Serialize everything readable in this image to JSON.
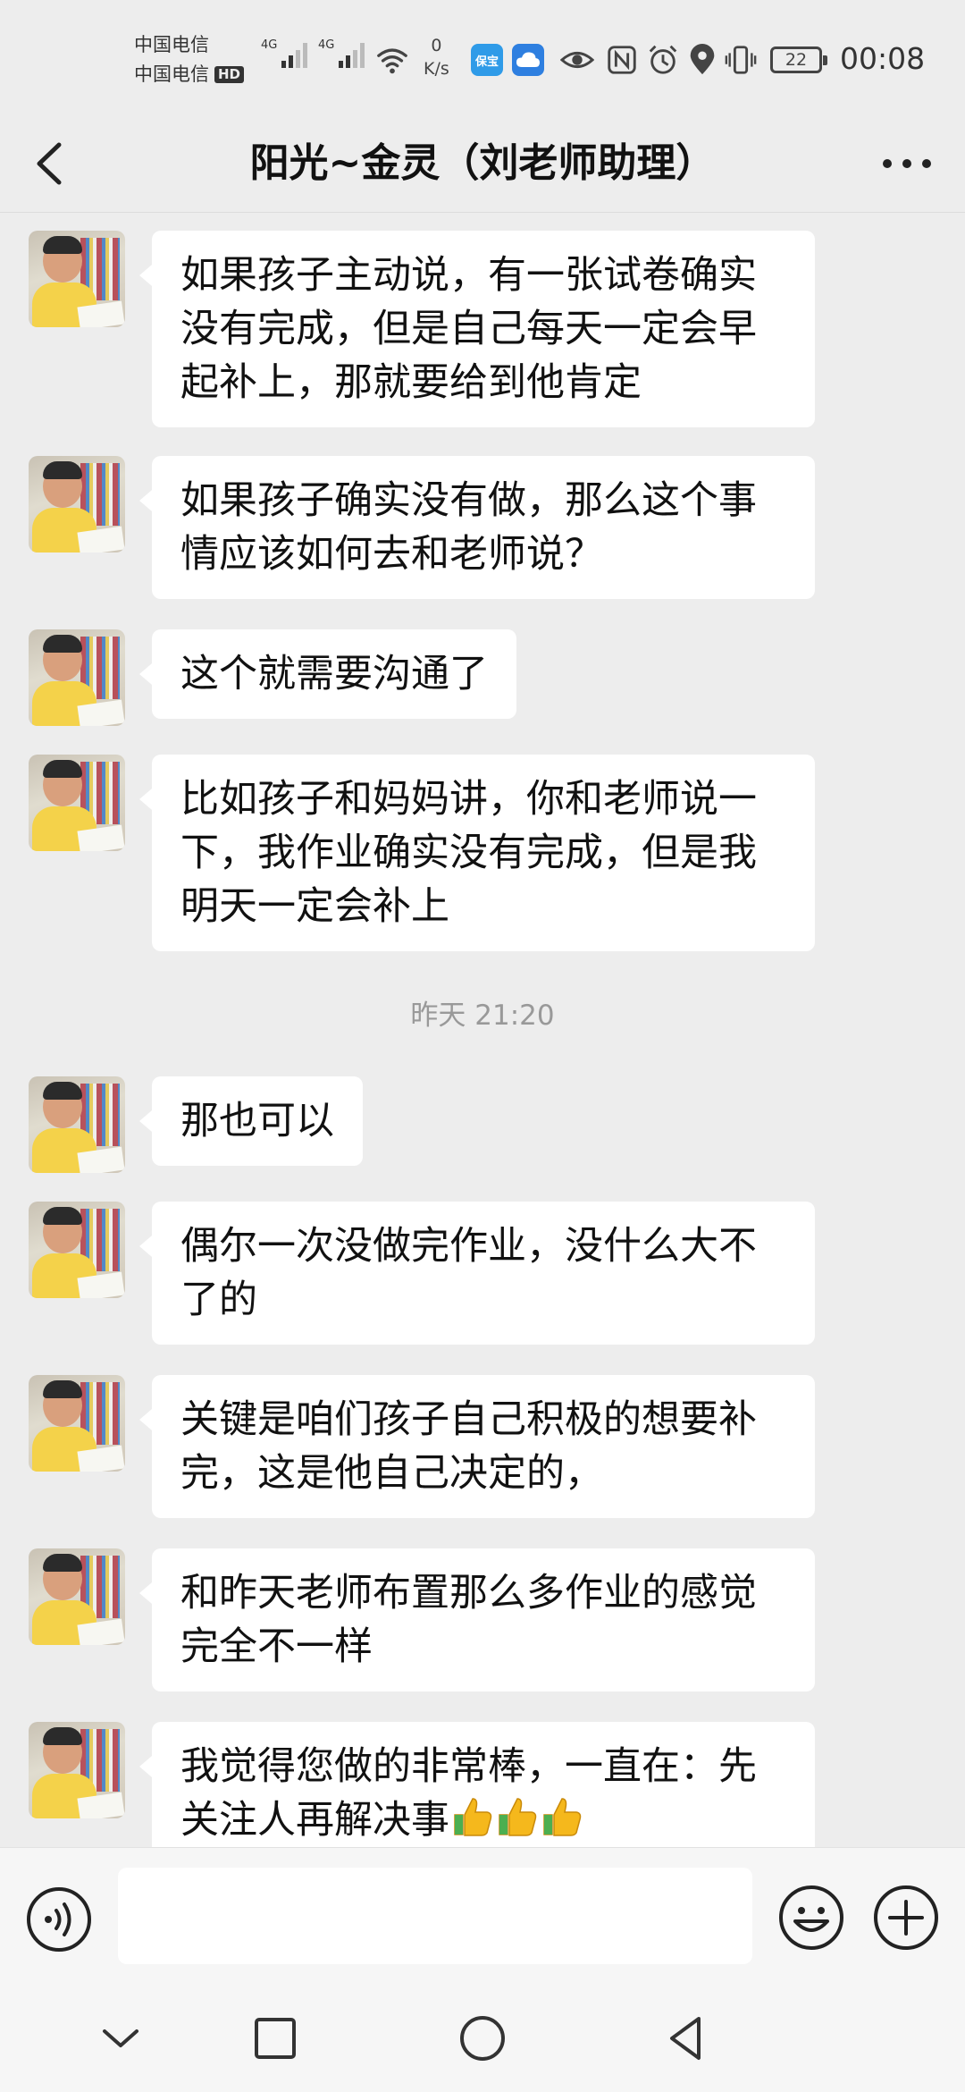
{
  "status_bar": {
    "carrier_1": "中国电信",
    "carrier_2": "中国电信",
    "hd_badge": "HD",
    "signal_1_label": "4G",
    "signal_2_label": "4G",
    "net_speed_value": "0",
    "net_speed_unit": "K/s",
    "app_badge_1": "保宝",
    "battery": "22",
    "time": "00:08"
  },
  "header": {
    "title": "阳光~金灵（刘老师助理）"
  },
  "messages": [
    {
      "text": "如果孩子主动说，有一张试卷确实没有完成，但是自己每天一定会早起补上，那就要给到他肯定"
    },
    {
      "text": "如果孩子确实没有做，那么这个事情应该如何去和老师说？"
    },
    {
      "text": "这个就需要沟通了"
    },
    {
      "text": "比如孩子和妈妈讲，你和老师说一下，我作业确实没有完成，但是我明天一定会补上"
    },
    {
      "text": "那也可以"
    },
    {
      "text": "偶尔一次没做完作业，没什么大不了的"
    },
    {
      "text": "关键是咱们孩子自己积极的想要补完，这是他自己决定的，"
    },
    {
      "text": "和昨天老师布置那么多作业的感觉完全不一样"
    },
    {
      "text": "我觉得您做的非常棒，一直在：先关注人再解决事"
    }
  ],
  "time_separator": "昨天 21:20",
  "input_bar": {
    "placeholder": ""
  },
  "colors": {
    "background": "#ededed",
    "bubble": "#ffffff",
    "thumbs_emoji": "#f5b81c"
  }
}
